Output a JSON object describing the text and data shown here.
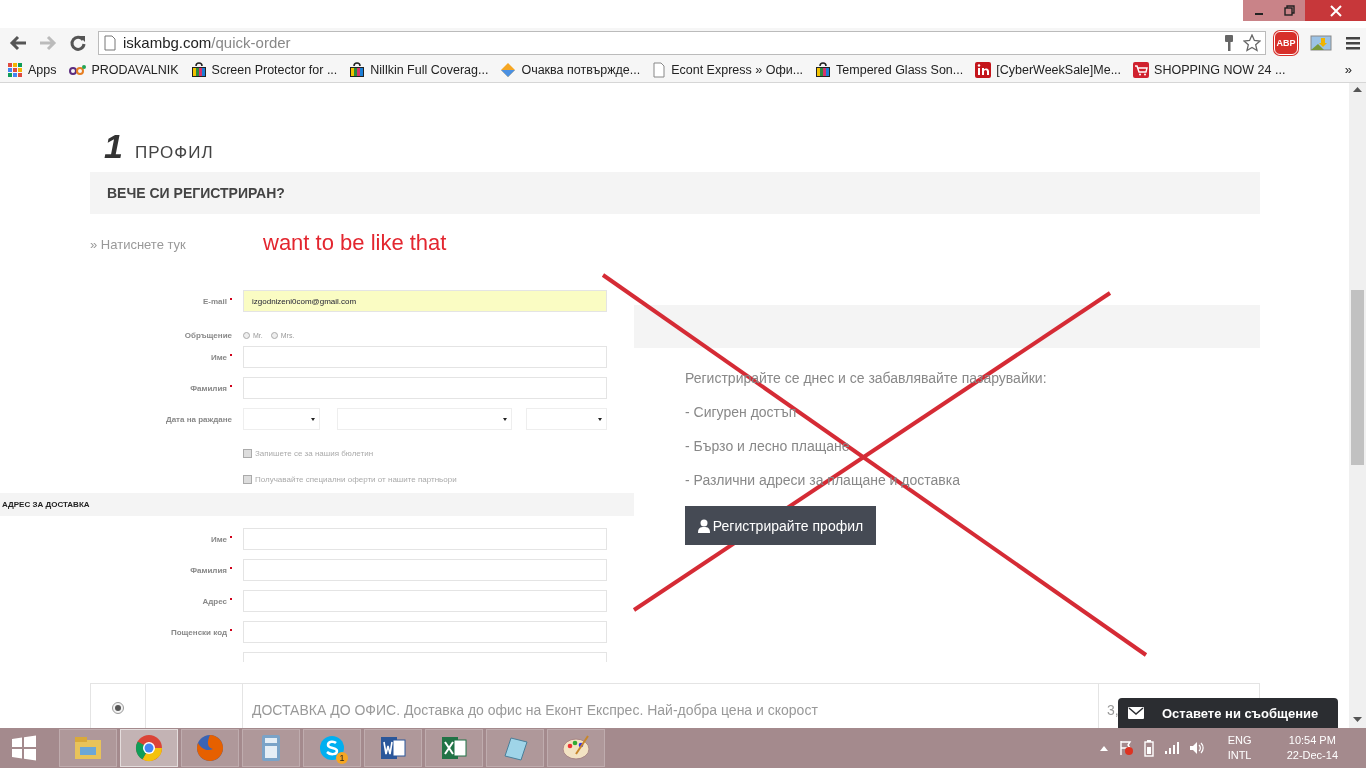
{
  "browser": {
    "address": {
      "domain": "iskambg.com",
      "path": "/quick-order"
    },
    "extension_label": "ABP",
    "bookmarks": [
      {
        "kind": "apps",
        "label": "Apps"
      },
      {
        "kind": "olx",
        "label": "PRODAVALNIK"
      },
      {
        "kind": "bag",
        "label": "Screen Protector for ..."
      },
      {
        "kind": "bag",
        "label": "Nillkin Full Coverag..."
      },
      {
        "kind": "diamond",
        "label": "Очаква потвържде..."
      },
      {
        "kind": "page",
        "label": "Econt Express » Офи..."
      },
      {
        "kind": "bag",
        "label": "Tempered Glass Son..."
      },
      {
        "kind": "linkedin",
        "label": "[CyberWeekSale]Me..."
      },
      {
        "kind": "cart",
        "label": "SHOPPING NOW 24 ..."
      }
    ],
    "more_bookmarks": "»"
  },
  "page": {
    "section_number": "1",
    "section_title": "ПРОФИЛ",
    "registered_bar": "ВЕЧЕ СИ РЕГИСТРИРАН?",
    "login_link": "» Натиснете тук",
    "annotation": "want to be like that",
    "pasted_form": {
      "rows": [
        {
          "kind": "text",
          "label": "E-mail",
          "required": true,
          "value": "izgodnizeni0com@gmail.com",
          "autofilled": true
        },
        {
          "kind": "radio",
          "label": "Обръщение",
          "options": [
            {
              "label": "Mr.",
              "selected": false
            },
            {
              "label": "Mrs.",
              "selected": false
            }
          ]
        },
        {
          "kind": "text",
          "label": "Име",
          "required": true,
          "autofilled": false
        },
        {
          "kind": "text",
          "label": "Фамилия",
          "required": true,
          "autofilled": false
        },
        {
          "kind": "date",
          "label": "Дата на раждане"
        },
        {
          "kind": "checkbox",
          "label": "Запишете се за нашия бюлетин",
          "checked": false
        },
        {
          "kind": "checkbox",
          "label": "Получавайте специални оферти от нашите партньори",
          "checked": false
        },
        {
          "kind": "section",
          "label": "АДРЕС ЗА ДОСТАВКА"
        },
        {
          "kind": "text",
          "label": "Име",
          "required": true,
          "autofilled": false
        },
        {
          "kind": "text",
          "label": "Фамилия",
          "required": true,
          "autofilled": false
        },
        {
          "kind": "text",
          "label": "Адрес",
          "required": true,
          "autofilled": false
        },
        {
          "kind": "text",
          "label": "Пощенски код",
          "required": true,
          "autofilled": false
        },
        {
          "kind": "text",
          "required": false,
          "autofilled": false
        }
      ]
    },
    "register_panel": {
      "intro": "Регистрирайте се днес и се забавлявайте пазарувайки:",
      "benefits": [
        "- Сигурен достъп",
        "- Бързо и лесно плащане",
        "- Различни адреси за плащане и доставка"
      ],
      "button": "Регистрирайте профил"
    },
    "delivery": {
      "selected": true,
      "label": "ДОСТАВКА ДО ОФИС. Доставка до офис на Еконт Експрес. Най-добра цена и скорост",
      "price": "3,"
    },
    "chat_button": "Оставете ни съобщение"
  },
  "taskbar": {
    "apps": [
      {
        "kind": "explorer",
        "active": false
      },
      {
        "kind": "chrome",
        "active": true
      },
      {
        "kind": "firefox",
        "active": false
      },
      {
        "kind": "calculator",
        "active": false
      },
      {
        "kind": "skype",
        "active": false,
        "badge": "1"
      },
      {
        "kind": "word",
        "active": false
      },
      {
        "kind": "excel",
        "active": false
      },
      {
        "kind": "notepad",
        "active": false
      },
      {
        "kind": "paint",
        "active": false
      }
    ],
    "language": [
      "ENG",
      "INTL"
    ],
    "time": "10:54 PM",
    "date": "22-Dec-14"
  }
}
